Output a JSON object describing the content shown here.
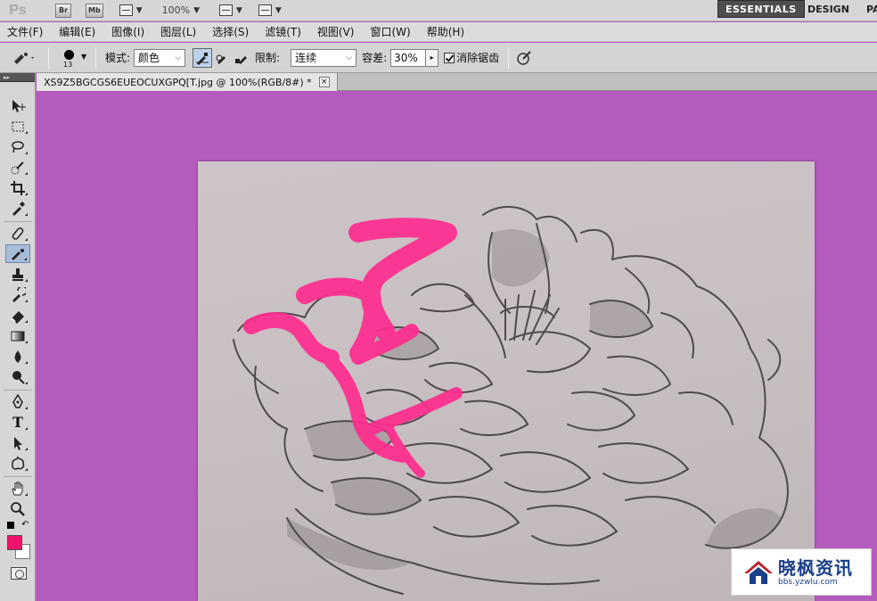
{
  "app": {
    "logo": "Ps",
    "bridge_label": "Br",
    "minibridge_label": "Mb",
    "zoom": "100%",
    "workspaces": {
      "active": "ESSENTIALS",
      "design": "DESIGN",
      "more": "PA"
    }
  },
  "menu": [
    "文件(F)",
    "编辑(E)",
    "图像(I)",
    "图层(L)",
    "选择(S)",
    "滤镜(T)",
    "视图(V)",
    "窗口(W)",
    "帮助(H)"
  ],
  "options": {
    "brush_size": "13",
    "mode_label": "模式:",
    "mode_value": "颜色",
    "limit_label": "限制:",
    "limit_value": "连续",
    "tolerance_label": "容差:",
    "tolerance_value": "30%",
    "antialias_label": "消除锯齿",
    "antialias_checked": true
  },
  "document": {
    "tab_title": "XS9Z5BGCGS6EUEOCUXGPQ[T.jpg @ 100%(RGB/8#) *",
    "close_symbol": "×"
  },
  "colors": {
    "foreground": "#f0136d",
    "background": "#ffffff",
    "canvas_bg": "#b45cbd",
    "paint": "#ff2d8f"
  },
  "toolbox": {
    "icons": [
      "move-icon",
      "marquee-icon",
      "lasso-icon",
      "quick-select-icon",
      "crop-icon",
      "eyedropper-icon",
      "healing-brush-icon",
      "color-replacement-icon",
      "clone-stamp-icon",
      "history-brush-icon",
      "eraser-icon",
      "gradient-icon",
      "blur-icon",
      "dodge-icon",
      "pen-icon",
      "type-icon",
      "path-select-icon",
      "shape-icon",
      "hand-icon",
      "zoom-icon"
    ],
    "type_tool_glyph": "T"
  },
  "watermark": {
    "title": "晓枫资讯",
    "url": "bbs.yzwlu.com"
  }
}
